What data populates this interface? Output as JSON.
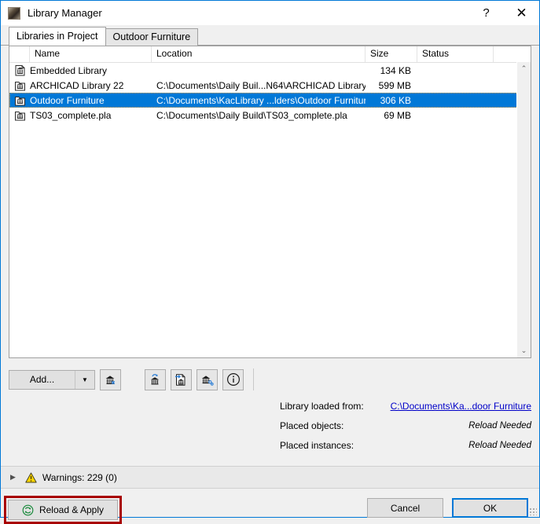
{
  "window": {
    "title": "Library Manager",
    "app_icon": "archicad-icon",
    "help_label": "?",
    "close_label": "✕",
    "accent_color": "#0078d7",
    "selection_color": "#0078d7",
    "highlight_color": "#a80000"
  },
  "tabs": [
    {
      "label": "Libraries in Project",
      "active": true
    },
    {
      "label": "Outdoor Furniture",
      "active": false
    }
  ],
  "table": {
    "columns": [
      {
        "key": "icon",
        "label": ""
      },
      {
        "key": "name",
        "label": "Name"
      },
      {
        "key": "location",
        "label": "Location"
      },
      {
        "key": "size",
        "label": "Size"
      },
      {
        "key": "status",
        "label": "Status"
      },
      {
        "key": "end",
        "label": ""
      }
    ],
    "rows": [
      {
        "icon": "embedded-library-icon",
        "name": "Embedded Library",
        "location": "",
        "size": "134 KB",
        "status": "",
        "selected": false
      },
      {
        "icon": "linked-library-icon",
        "name": "ARCHICAD Library 22",
        "location": "C:\\Documents\\Daily Buil...N64\\ARCHICAD Library 22",
        "size": "599 MB",
        "status": "",
        "selected": false
      },
      {
        "icon": "linked-library-icon",
        "name": "Outdoor Furniture",
        "location": "C:\\Documents\\KacLibrary ...lders\\Outdoor Furniture",
        "size": "306 KB",
        "status": "",
        "selected": true
      },
      {
        "icon": "linked-library-icon",
        "name": "TS03_complete.pla",
        "location": "C:\\Documents\\Daily Build\\TS03_complete.pla",
        "size": "69 MB",
        "status": "",
        "selected": false
      }
    ],
    "scrollbar": {
      "up_arrow": "⌃",
      "down_arrow": "⌄"
    }
  },
  "toolbar": {
    "add_label": "Add...",
    "add_dropdown_icon": "chevron-down-icon",
    "remove_icon": "remove-library-icon",
    "reload_library_icon": "reload-library-icon",
    "export_library_icon": "export-library-icon",
    "library_settings_icon": "library-settings-icon",
    "info_icon": "info-icon"
  },
  "info": {
    "loaded_from_label": "Library loaded from:",
    "loaded_from_value": "C:\\Documents\\Ka...door Furniture",
    "placed_objects_label": "Placed objects:",
    "placed_objects_value": "Reload Needed",
    "placed_instances_label": "Placed instances:",
    "placed_instances_value": "Reload Needed"
  },
  "warnings": {
    "chevron_icon": "chevron-right-icon",
    "warning_icon": "warning-triangle-icon",
    "label": "Warnings: 229 (0)"
  },
  "footer": {
    "reload_apply_label": "Reload & Apply",
    "reload_apply_icon": "refresh-circle-icon",
    "cancel_label": "Cancel",
    "ok_label": "OK"
  }
}
